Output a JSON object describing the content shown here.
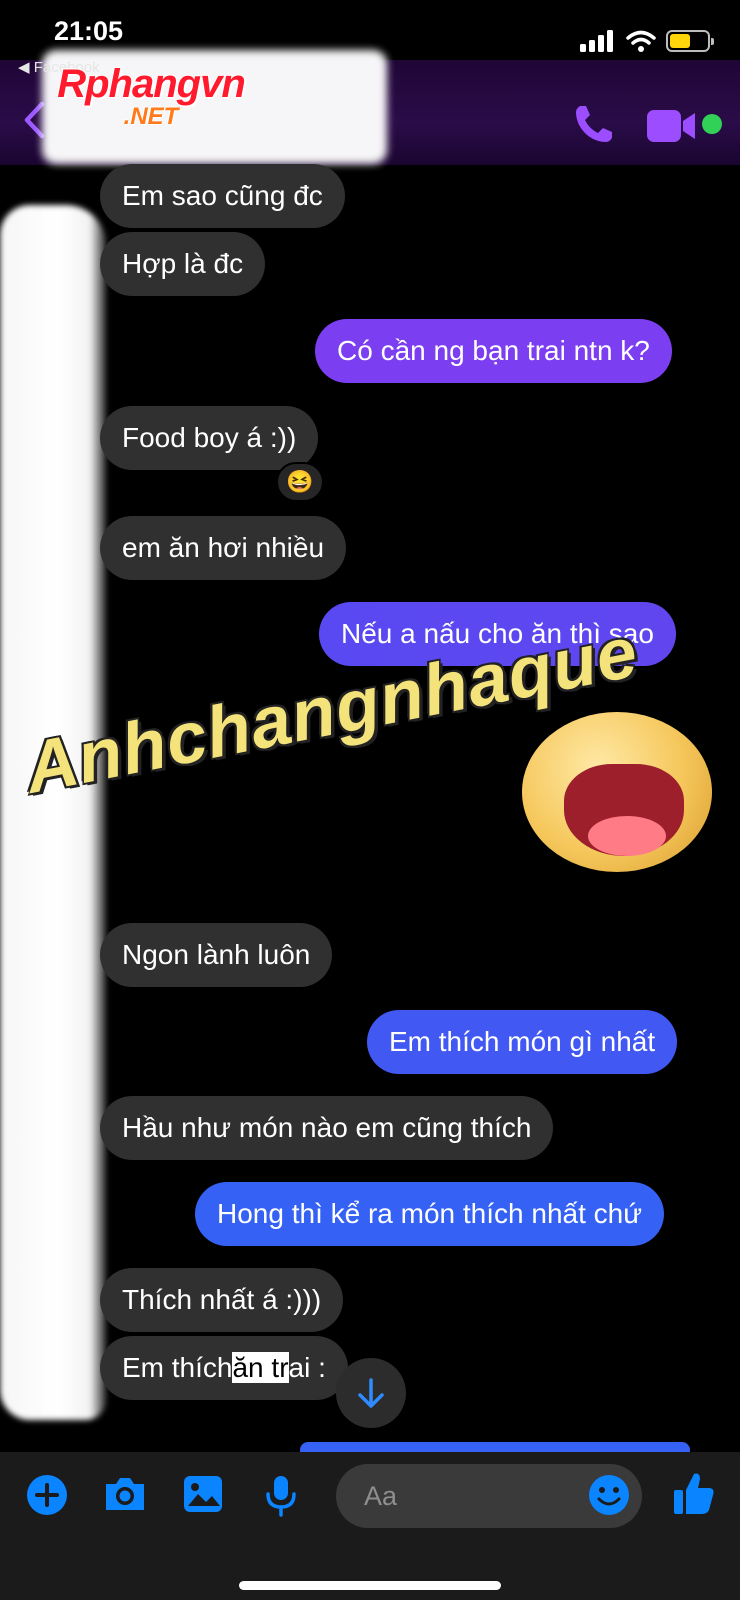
{
  "status_bar": {
    "time": "21:05",
    "back_app": "◀ Facebook"
  },
  "header": {
    "call_icon": "phone-icon",
    "video_icon": "video-icon"
  },
  "watermark": {
    "main": "Rphangvn",
    "sub": ".NET"
  },
  "messages": [
    {
      "side": "in",
      "text": "Em sao cũng đc"
    },
    {
      "side": "in",
      "text": "Hợp là đc"
    },
    {
      "side": "out",
      "text": "Có cần ng bạn trai ntn k?"
    },
    {
      "side": "in",
      "text": "Food boy á :))"
    },
    {
      "side": "in",
      "text": "em ăn hơi nhiều"
    },
    {
      "side": "out",
      "text": "Nếu a nấu cho ăn thì sao"
    },
    {
      "side": "in",
      "text": "Ngon lành luôn"
    },
    {
      "side": "out",
      "text": "Em thích món gì nhất"
    },
    {
      "side": "in",
      "text": "Hầu như món nào em cũng thích"
    },
    {
      "side": "out",
      "text": "Hong thì kể ra món thích nhất chứ"
    },
    {
      "side": "in",
      "text": "Thích nhất á :)))"
    },
    {
      "side": "in",
      "text_parts": [
        "Em thích",
        "ăn tr",
        "ai :"
      ]
    }
  ],
  "reaction": "😆",
  "sticker": {
    "text": "Anhchangnhaque"
  },
  "composer": {
    "placeholder": "Aa"
  },
  "colors": {
    "incoming_bubble": "#303030",
    "outgoing_blue": "#3562f5",
    "outgoing_purple": "#7b3ef0",
    "accent": "#0a84ff",
    "online": "#31d158"
  }
}
